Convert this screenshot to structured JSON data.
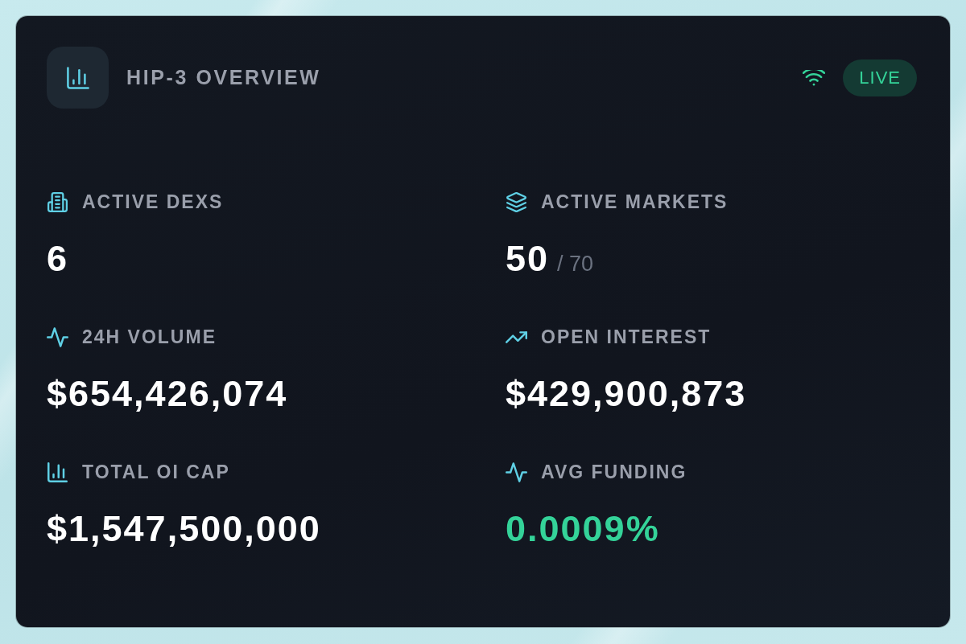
{
  "header": {
    "title": "HIP-3 OVERVIEW",
    "status": "LIVE"
  },
  "stats": [
    {
      "label": "ACTIVE DEXS",
      "value": "6",
      "positive": false
    },
    {
      "label": "ACTIVE MARKETS",
      "value": "50",
      "total": "/ 70",
      "positive": false
    },
    {
      "label": "24H VOLUME",
      "value": "$654,426,074",
      "positive": false
    },
    {
      "label": "OPEN INTEREST",
      "value": "$429,900,873",
      "positive": false
    },
    {
      "label": "TOTAL OI CAP",
      "value": "$1,547,500,000",
      "positive": false
    },
    {
      "label": "AVG FUNDING",
      "value": "0.0009%",
      "positive": true
    }
  ]
}
